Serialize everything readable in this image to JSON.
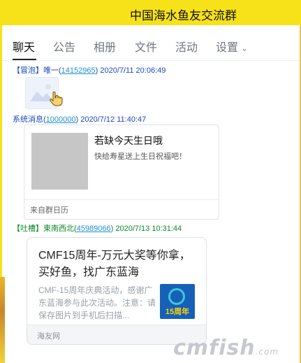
{
  "group_title": "中国海水鱼友交流群",
  "tabs": [
    {
      "label": "聊天"
    },
    {
      "label": "公告"
    },
    {
      "label": "相册"
    },
    {
      "label": "文件"
    },
    {
      "label": "活动"
    },
    {
      "label": "设置"
    }
  ],
  "messages": [
    {
      "tag": "【冒泡】",
      "name": "唯一",
      "qq": "14152965",
      "time": "2020/7/11 20:06:49"
    },
    {
      "name": "系统消息",
      "qq": "1000000",
      "time": "2020/7/12 11:40:47",
      "card": {
        "title": "若缺今天生日哦",
        "subtitle": "快给寿星送上生日祝福吧！",
        "source": "来自群日历"
      }
    },
    {
      "tag": "【吐槽】",
      "name": "東南西北",
      "qq": "45989066",
      "time": "2020/7/13 10:31:44",
      "card": {
        "title": "CMF15周年-万元大奖等你拿，买好鱼，找广东蓝海",
        "desc": "CMF-15周年庆典活动，感谢广东蓝海参与此次活动。注意：请保存图片到手机后扫描...",
        "logo_text": "15周年",
        "source": "海友网"
      }
    }
  ],
  "watermark": {
    "main": "cmfish",
    "suffix": ".com"
  },
  "colors": {
    "titlebar": "#f7e21a",
    "link": "#1f8fd6",
    "tag_blue": "#1a47c9",
    "tag_green": "#0a8a2a"
  }
}
